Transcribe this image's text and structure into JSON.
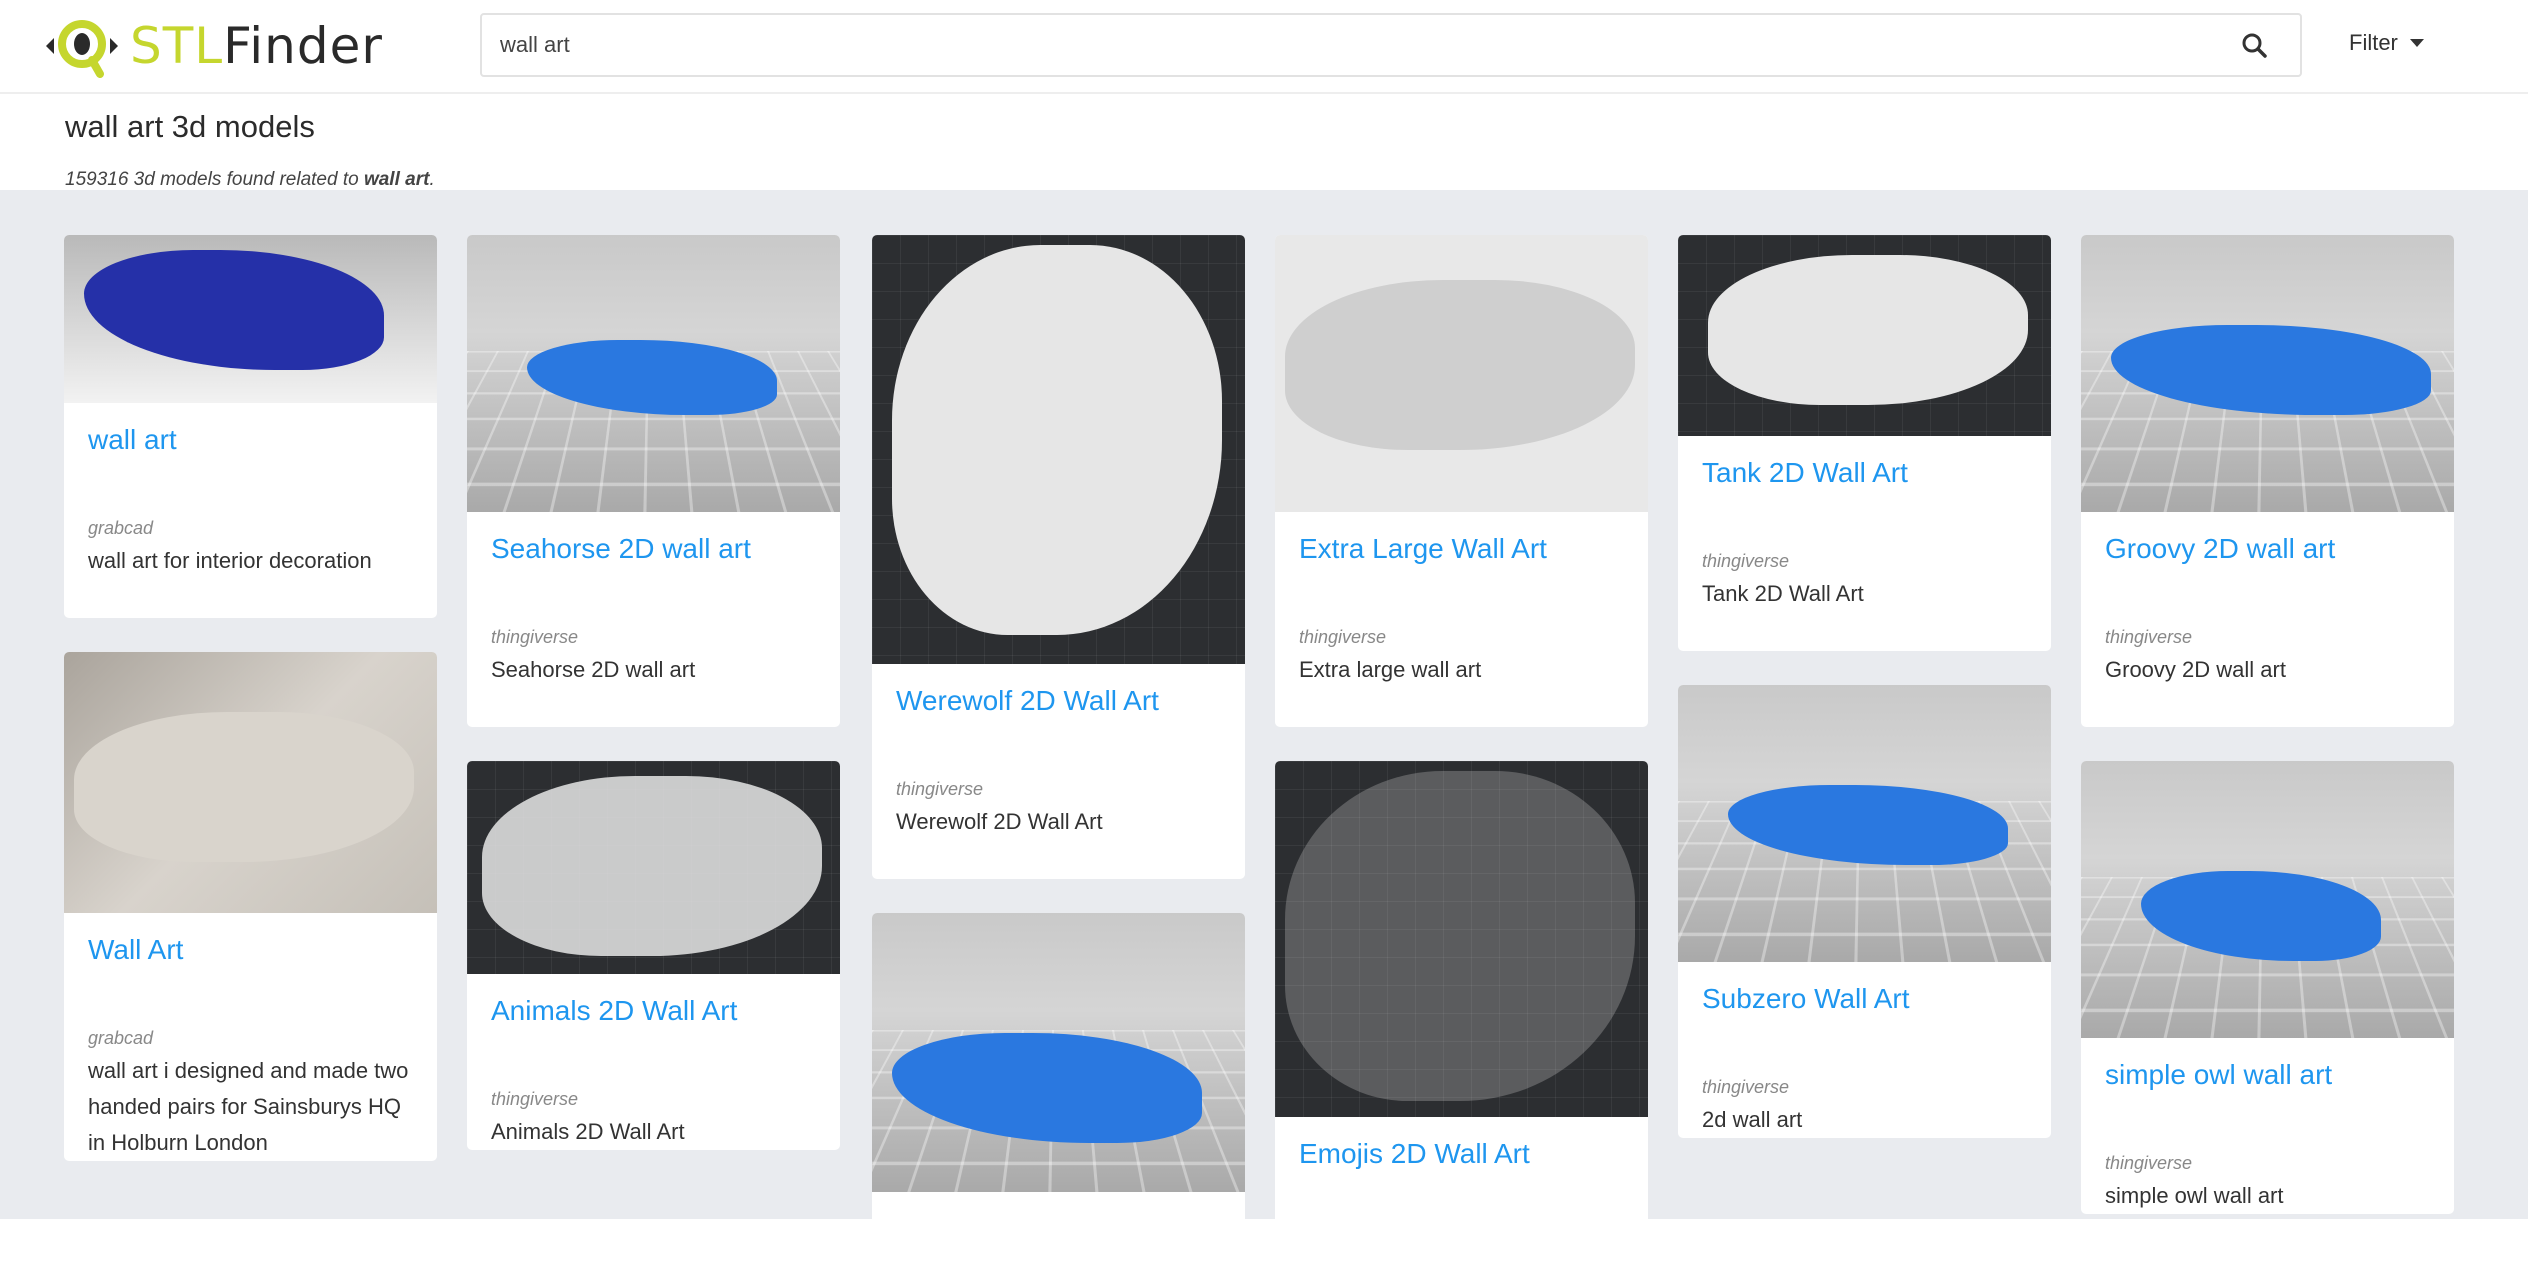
{
  "header": {
    "logo_text": "STLFinder",
    "logo_part1": "STL",
    "logo_part2": "Finder",
    "search_value": "wall art",
    "search_icon": "search-icon",
    "filter_label": "Filter"
  },
  "page": {
    "title": "wall art 3d models",
    "count": "159316",
    "found_text": " 3d models found related to ",
    "query": "wall art",
    "period": "."
  },
  "colors": {
    "accent": "#1e96ef",
    "background": "#e9ebef",
    "logo_green": "#c5d62e"
  },
  "columns": [
    [
      {
        "title": "wall art",
        "source": "grabcad",
        "description": "wall art for interior decoration"
      },
      {
        "title": "Wall Art",
        "source": "grabcad",
        "description": "wall art i designed and made two handed pairs for Sainsburys HQ in Holburn London"
      }
    ],
    [
      {
        "title": "Seahorse 2D wall art",
        "source": "thingiverse",
        "description": "Seahorse 2D wall art"
      },
      {
        "title": "Animals 2D Wall Art",
        "source": "thingiverse",
        "description": "Animals 2D Wall Art"
      }
    ],
    [
      {
        "title": "Werewolf 2D Wall Art",
        "source": "thingiverse",
        "description": "Werewolf 2D Wall Art"
      },
      {
        "title": "",
        "source": "",
        "description": ""
      }
    ],
    [
      {
        "title": "Extra Large Wall Art",
        "source": "thingiverse",
        "description": "Extra large wall art"
      },
      {
        "title": "Emojis 2D Wall Art",
        "source": "",
        "description": ""
      }
    ],
    [
      {
        "title": "Tank 2D Wall Art",
        "source": "thingiverse",
        "description": "Tank 2D Wall Art"
      },
      {
        "title": "Subzero Wall Art",
        "source": "thingiverse",
        "description": "2d wall art"
      }
    ],
    [
      {
        "title": "Groovy 2D wall art",
        "source": "thingiverse",
        "description": "Groovy 2D wall art"
      },
      {
        "title": "simple owl wall art",
        "source": "thingiverse",
        "description": "simple owl wall art"
      }
    ]
  ]
}
